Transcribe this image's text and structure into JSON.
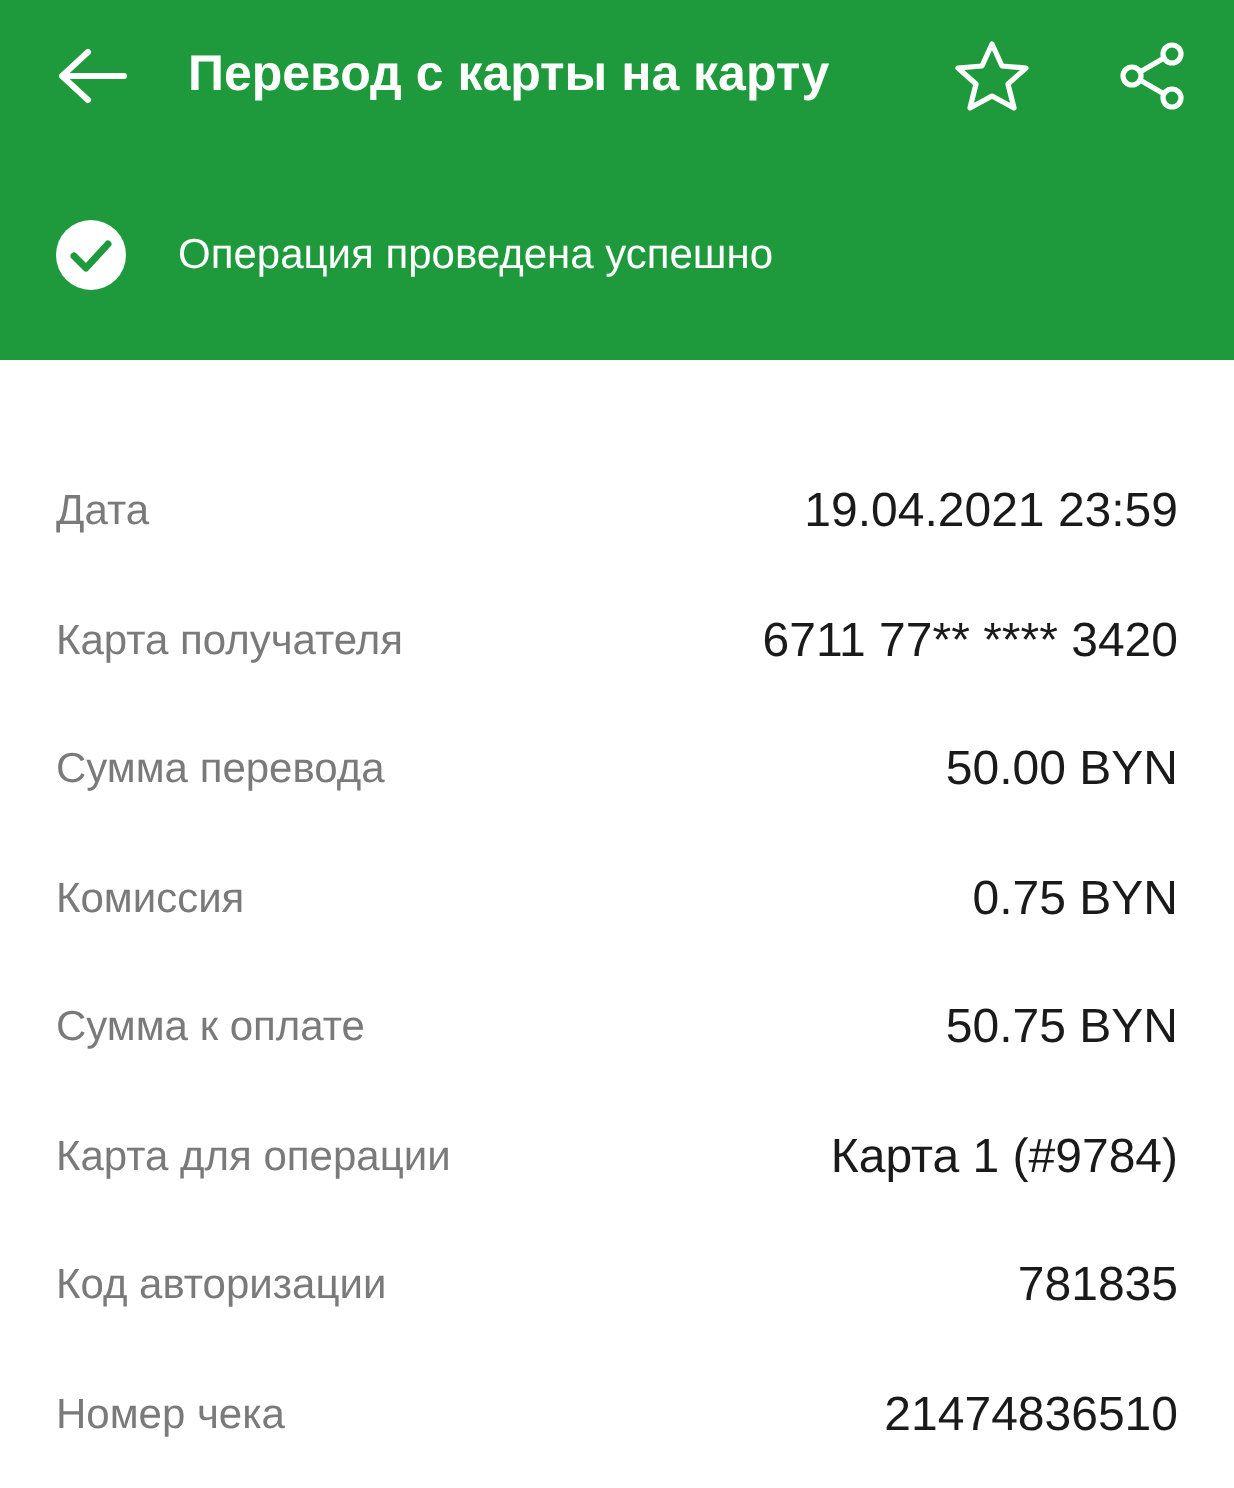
{
  "app_bar": {
    "title": "Перевод с карты на карту",
    "favorite": false
  },
  "status": {
    "message": "Операция проведена успешно"
  },
  "details": [
    {
      "label": "Дата",
      "value": "19.04.2021 23:59"
    },
    {
      "label": "Карта получателя",
      "value": "6711 77** **** 3420"
    },
    {
      "label": "Сумма перевода",
      "value": "50.00 BYN"
    },
    {
      "label": "Комиссия",
      "value": "0.75 BYN"
    },
    {
      "label": "Сумма к оплате",
      "value": "50.75 BYN"
    },
    {
      "label": "Карта для операции",
      "value": "Карта 1 (#9784)"
    },
    {
      "label": "Код авторизации",
      "value": "781835"
    },
    {
      "label": "Номер чека",
      "value": "21474836510"
    }
  ]
}
